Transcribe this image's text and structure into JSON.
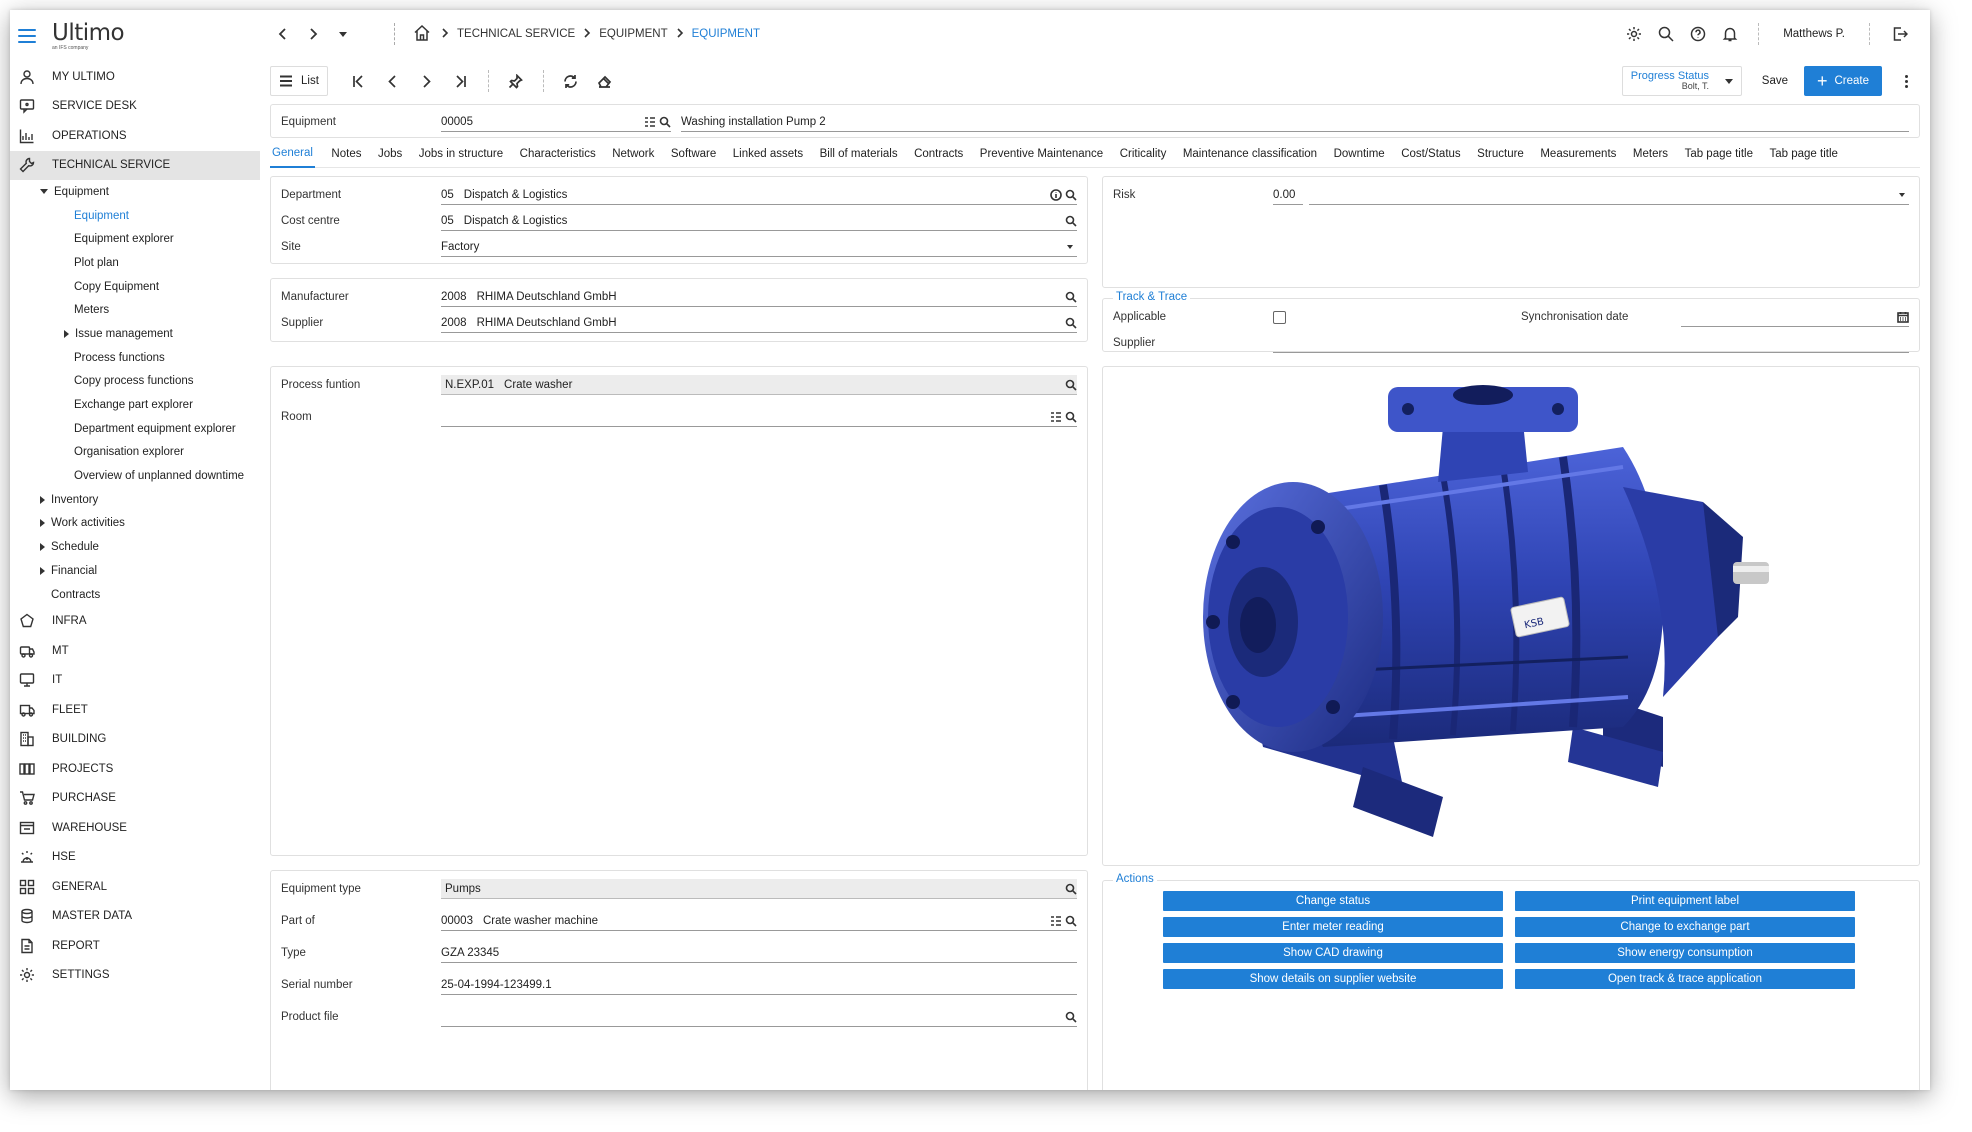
{
  "brand": {
    "name": "Ultimo",
    "tagline": "an IFS company"
  },
  "sidebar": {
    "top_items": [
      {
        "label": "MY ULTIMO",
        "icon": "user-icon"
      },
      {
        "label": "SERVICE DESK",
        "icon": "chat-icon"
      },
      {
        "label": "OPERATIONS",
        "icon": "chart-icon"
      },
      {
        "label": "TECHNICAL SERVICE",
        "icon": "wrench-icon"
      }
    ],
    "technical_service": {
      "equipment_label": "Equipment",
      "equipment_children": [
        "Equipment",
        "Equipment explorer",
        "Plot plan",
        "Copy Equipment",
        "Meters",
        "Issue management",
        "Process functions",
        "Copy process functions",
        "Exchange part explorer",
        "Department equipment explorer",
        "Organisation explorer",
        "Overview of unplanned downtime"
      ],
      "other_children": [
        "Inventory",
        "Work activities",
        "Schedule",
        "Financial",
        "Contracts"
      ]
    },
    "bottom_items": [
      {
        "label": "INFRA",
        "icon": "infra-icon"
      },
      {
        "label": "MT",
        "icon": "mt-icon"
      },
      {
        "label": "IT",
        "icon": "monitor-icon"
      },
      {
        "label": "FLEET",
        "icon": "truck-icon"
      },
      {
        "label": "BUILDING",
        "icon": "building-icon"
      },
      {
        "label": "PROJECTS",
        "icon": "projects-icon"
      },
      {
        "label": "PURCHASE",
        "icon": "cart-icon"
      },
      {
        "label": "WAREHOUSE",
        "icon": "warehouse-icon"
      },
      {
        "label": "HSE",
        "icon": "hse-icon"
      },
      {
        "label": "GENERAL",
        "icon": "grid-icon"
      },
      {
        "label": "MASTER DATA",
        "icon": "database-icon"
      },
      {
        "label": "REPORT",
        "icon": "report-icon"
      },
      {
        "label": "SETTINGS",
        "icon": "gear-icon"
      }
    ]
  },
  "header": {
    "breadcrumbs": [
      "TECHNICAL SERVICE",
      "EQUIPMENT",
      "EQUIPMENT"
    ],
    "user": "Matthews P."
  },
  "toolbar": {
    "list_label": "List",
    "progress_status_label": "Progress Status",
    "progress_status_user": "Bolt, T.",
    "save_label": "Save",
    "create_label": "Create"
  },
  "record": {
    "label": "Equipment",
    "code": "00005",
    "description": "Washing installation Pump 2"
  },
  "tabs": [
    "General",
    "Notes",
    "Jobs",
    "Jobs in structure",
    "Characteristics",
    "Network",
    "Software",
    "Linked assets",
    "Bill of materials",
    "Contracts",
    "Preventive Maintenance",
    "Criticality",
    "Maintenance classification",
    "Downtime",
    "Cost/Status",
    "Structure",
    "Measurements",
    "Meters",
    "Tab page title",
    "Tab page title"
  ],
  "org": {
    "department": {
      "label": "Department",
      "code": "05",
      "value": "Dispatch & Logistics"
    },
    "cost_centre": {
      "label": "Cost centre",
      "code": "05",
      "value": "Dispatch & Logistics"
    },
    "site": {
      "label": "Site",
      "value": "Factory"
    }
  },
  "risk": {
    "label": "Risk",
    "value": "0.00"
  },
  "suppliers": {
    "manufacturer": {
      "label": "Manufacturer",
      "code": "2008",
      "value": "RHIMA Deutschland GmbH"
    },
    "supplier": {
      "label": "Supplier",
      "code": "2008",
      "value": "RHIMA Deutschland GmbH"
    }
  },
  "track": {
    "legend": "Track & Trace",
    "applicable_label": "Applicable",
    "sync_label": "Synchronisation date",
    "supplier_label": "Supplier"
  },
  "process": {
    "function": {
      "label": "Process funtion",
      "code": "N.EXP.01",
      "value": "Crate washer"
    },
    "room": {
      "label": "Room",
      "value": ""
    }
  },
  "details": {
    "equipment_type": {
      "label": "Equipment type",
      "value": "Pumps"
    },
    "part_of": {
      "label": "Part of",
      "code": "00003",
      "value": "Crate washer machine"
    },
    "type": {
      "label": "Type",
      "value": "GZA 23345"
    },
    "serial": {
      "label": "Serial number",
      "value": "25-04-1994-123499.1"
    },
    "product_file": {
      "label": "Product file",
      "value": ""
    }
  },
  "image": {
    "brand_plate": "KSB"
  },
  "actions": {
    "legend": "Actions",
    "buttons": [
      "Change status",
      "Print equipment label",
      "Enter meter reading",
      "Change to exchange part",
      "Show CAD drawing",
      "Show energy consumption",
      "Show details on supplier website",
      "Open track & trace application"
    ]
  },
  "colors": {
    "accent": "#1f7fd6",
    "pump_blue": "#2c3fa8"
  }
}
